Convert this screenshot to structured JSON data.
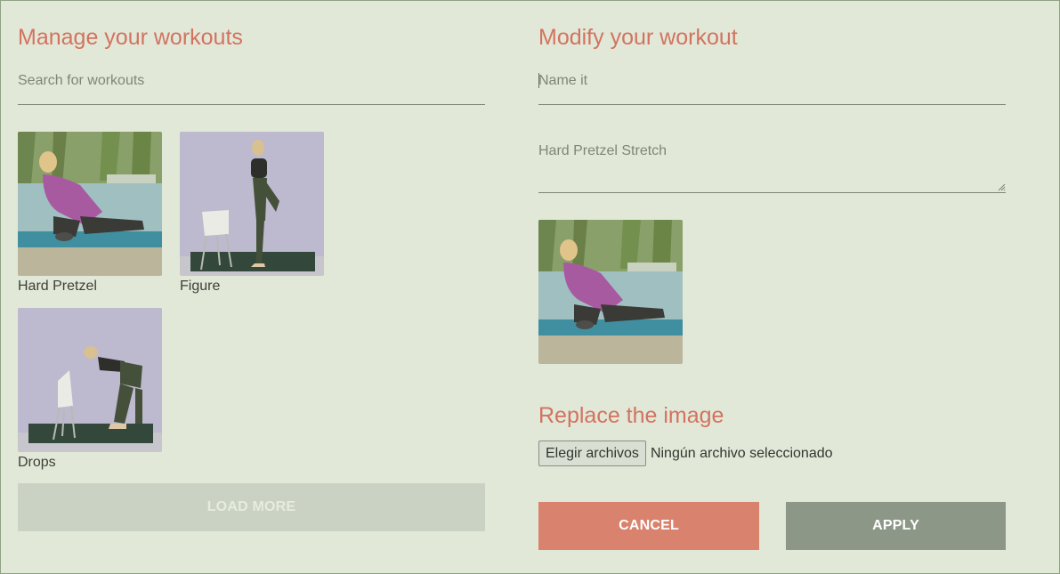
{
  "left": {
    "title": "Manage your workouts",
    "search_placeholder": "Search for workouts",
    "workouts": [
      {
        "label": "Hard Pretzel"
      },
      {
        "label": "Figure"
      },
      {
        "label": "Drops"
      }
    ],
    "load_more_label": "LOAD MORE"
  },
  "right": {
    "title": "Modify your workout",
    "name_placeholder": "Name it",
    "description_placeholder": "Hard Pretzel Stretch",
    "replace_title": "Replace the image",
    "file_button_label": "Elegir archivos",
    "file_status": "Ningún archivo seleccionado",
    "cancel_label": "CANCEL",
    "apply_label": "APPLY"
  },
  "colors": {
    "accent": "#d2735f",
    "background": "#e2e8d8",
    "cancel": "#d9826d",
    "apply": "#8d9787",
    "load_more": "#cad3c3"
  }
}
